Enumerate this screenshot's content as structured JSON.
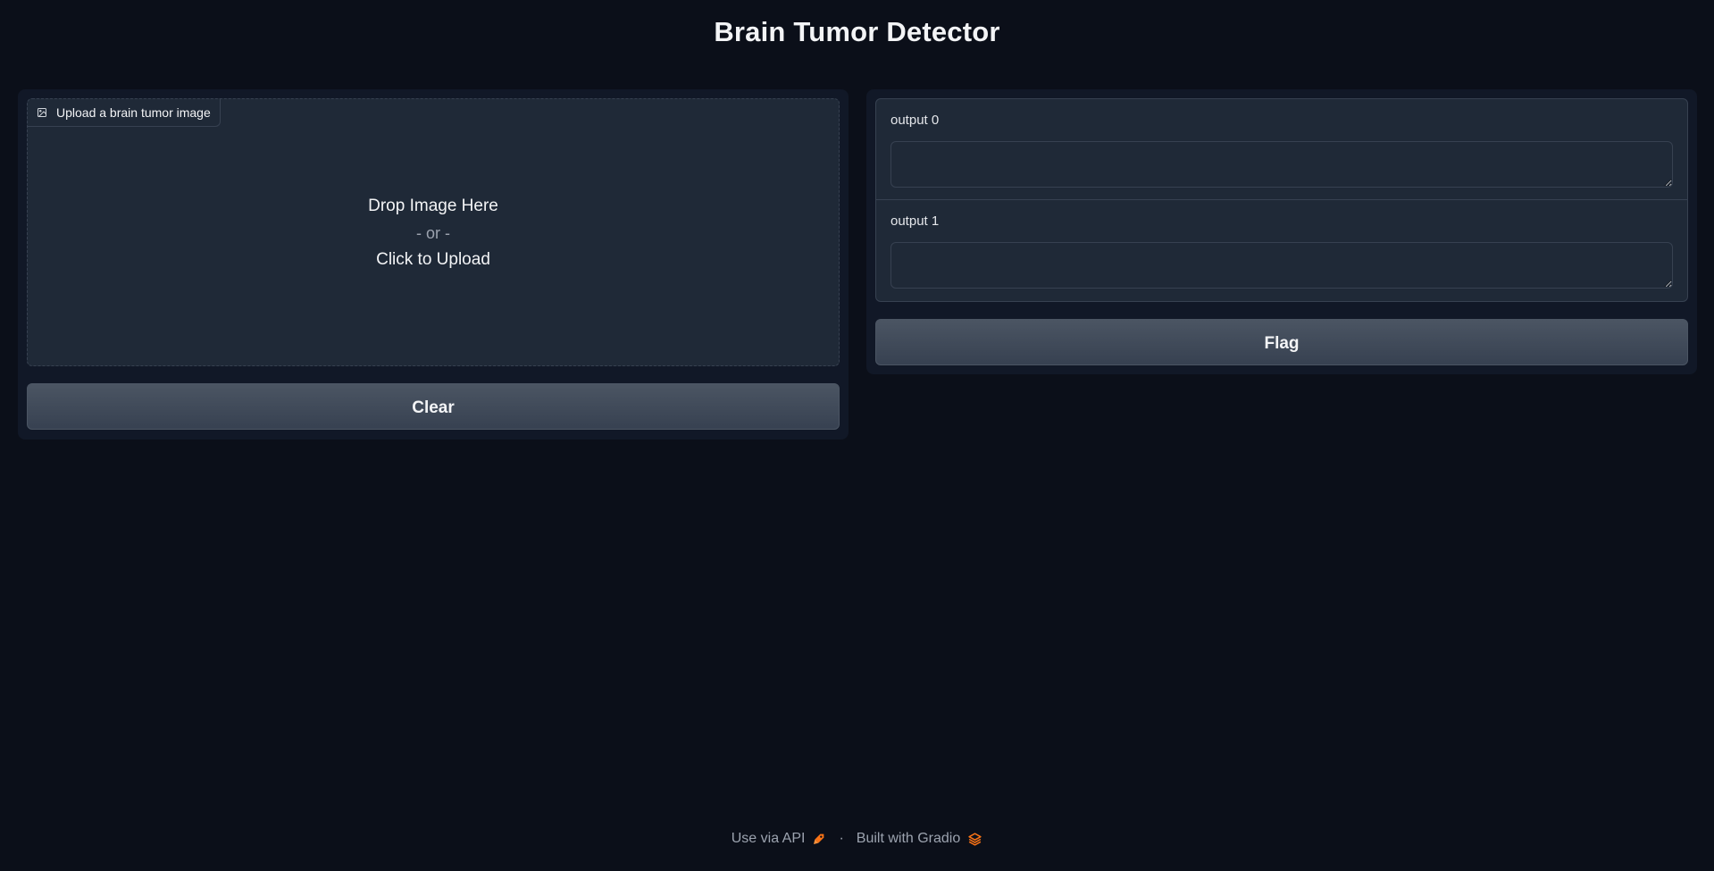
{
  "app": {
    "title": "Brain Tumor Detector"
  },
  "input": {
    "label": "Upload a brain tumor image",
    "label_icon": "image-icon",
    "drop_text": "Drop Image Here",
    "or_text": "- or -",
    "click_text": "Click to Upload",
    "clear_label": "Clear"
  },
  "outputs": [
    {
      "label": "output 0",
      "value": ""
    },
    {
      "label": "output 1",
      "value": ""
    }
  ],
  "actions": {
    "flag_label": "Flag"
  },
  "footer": {
    "api_link": "Use via API",
    "api_icon": "rocket-icon",
    "separator": "·",
    "built_with": "Built with Gradio",
    "gradio_icon": "gradio-logo-icon"
  },
  "colors": {
    "background": "#0b0f19",
    "panel": "#111827",
    "block": "#1f2937",
    "border": "#374151",
    "accent": "#f97316"
  }
}
